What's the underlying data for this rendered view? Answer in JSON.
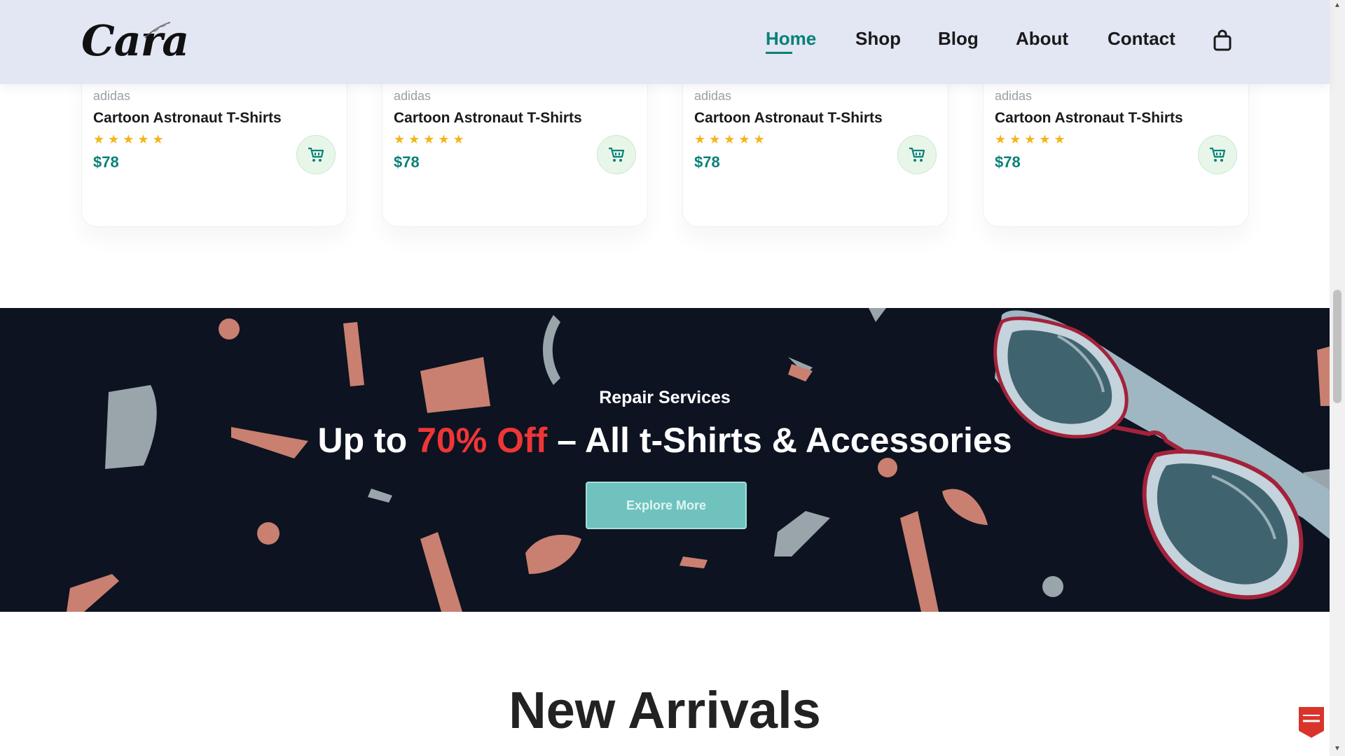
{
  "header": {
    "logo": "Cara",
    "nav": [
      {
        "label": "Home",
        "active": true
      },
      {
        "label": "Shop",
        "active": false
      },
      {
        "label": "Blog",
        "active": false
      },
      {
        "label": "About",
        "active": false
      },
      {
        "label": "Contact",
        "active": false
      }
    ],
    "cart_icon": "shopping-bag-icon"
  },
  "products": [
    {
      "brand": "adidas",
      "title": "Cartoon Astronaut T-Shirts",
      "rating": 5,
      "stars": "★★★★★",
      "price": "$78",
      "cart_icon": "cart-icon"
    },
    {
      "brand": "adidas",
      "title": "Cartoon Astronaut T-Shirts",
      "rating": 5,
      "stars": "★★★★★",
      "price": "$78",
      "cart_icon": "cart-icon"
    },
    {
      "brand": "adidas",
      "title": "Cartoon Astronaut T-Shirts",
      "rating": 5,
      "stars": "★★★★★",
      "price": "$78",
      "cart_icon": "cart-icon"
    },
    {
      "brand": "adidas",
      "title": "Cartoon Astronaut T-Shirts",
      "rating": 5,
      "stars": "★★★★★",
      "price": "$78",
      "cart_icon": "cart-icon"
    }
  ],
  "banner": {
    "subtitle": "Repair Services",
    "title_prefix": "Up to ",
    "title_highlight": "70% Off",
    "title_suffix": " – All t-Shirts & Accessories",
    "button_label": "Explore More"
  },
  "section": {
    "title": "New Arrivals"
  },
  "colors": {
    "accent": "#088178",
    "header_bg": "#e3e6f3",
    "banner_bg": "#0d1321",
    "highlight": "#ef3636",
    "star": "#f3b519"
  }
}
